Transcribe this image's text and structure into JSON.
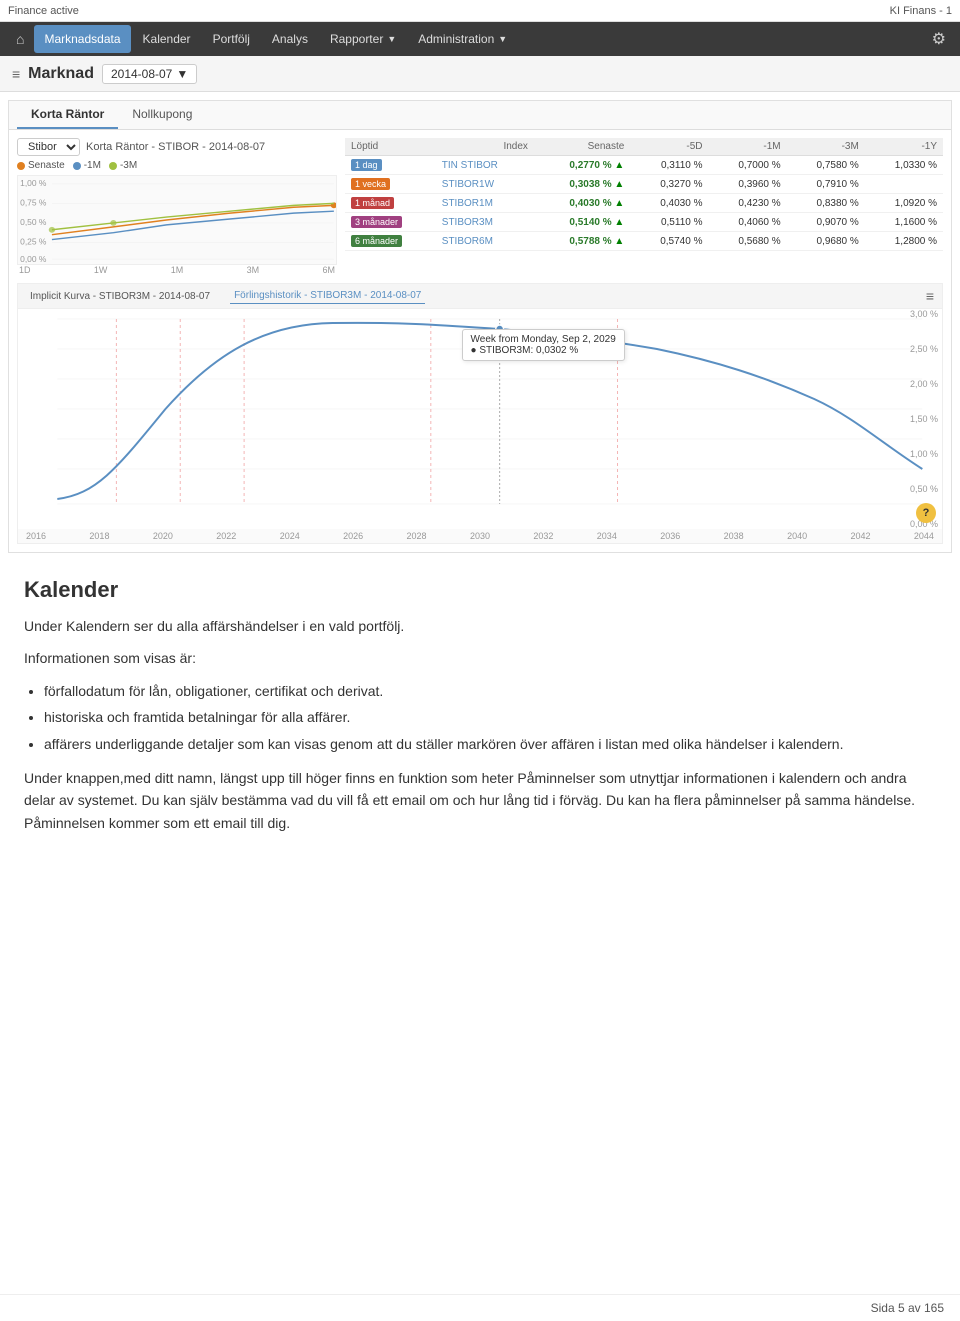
{
  "topbar": {
    "left": "Finance active",
    "right": "KI Finans - 1"
  },
  "navbar": {
    "home_icon": "⌂",
    "items": [
      {
        "label": "Marknadsdata",
        "active": true,
        "has_dropdown": false
      },
      {
        "label": "Kalender",
        "active": false,
        "has_dropdown": false
      },
      {
        "label": "Portfölj",
        "active": false,
        "has_dropdown": false
      },
      {
        "label": "Analys",
        "active": false,
        "has_dropdown": false
      },
      {
        "label": "Rapporter",
        "active": false,
        "has_dropdown": true
      },
      {
        "label": "Administration",
        "active": false,
        "has_dropdown": true
      }
    ],
    "right_icon": "⚙"
  },
  "subheader": {
    "icon": "≡",
    "title": "Marknad",
    "date": "2014-08-07",
    "date_icon": "▼"
  },
  "tabs": {
    "items": [
      {
        "label": "Korta Räntor",
        "active": true
      },
      {
        "label": "Nollkupong",
        "active": false
      }
    ]
  },
  "chart_header": {
    "title": "Korta Räntor - STIBOR - 2014-08-07",
    "stibor_label": "Stibor",
    "stibor_dropdown": "▼"
  },
  "chart_legend": [
    {
      "label": "Senaste",
      "color": "#e08020"
    },
    {
      "label": "-1M",
      "color": "#5a8fc2"
    },
    {
      "label": "-3M",
      "color": "#a0c040"
    }
  ],
  "x_axis_labels": [
    "1D",
    "1W",
    "1M",
    "3M",
    "6M"
  ],
  "data_table": {
    "headers": [
      "Löptid",
      "Index",
      "Senaste",
      "-5D",
      "-1M",
      "-3M",
      "-1Y"
    ],
    "rows": [
      {
        "period": "1 dag",
        "color_class": "1",
        "index": "TIN STIBOR",
        "senaste": "0,2770 %",
        "senaste_dir": "up",
        "d5": "0,3110 %",
        "m1": "0,7000 %",
        "m3": "0,7580 %",
        "y1": "1,0330 %"
      },
      {
        "period": "1 vecka",
        "color_class": "2",
        "index": "STIBOR1W",
        "senaste": "0,3038 %",
        "senaste_dir": "up",
        "d5": "0,3270 %",
        "m1": "0,3960 %",
        "m3": "0,7910 %",
        "y1": ""
      },
      {
        "period": "1 månad",
        "color_class": "3",
        "index": "STIBOR1M",
        "senaste": "0,4030 %",
        "senaste_dir": "up",
        "d5": "0,4030 %",
        "m1": "0,4230 %",
        "m3": "0,8380 %",
        "y1": "1,0920 %"
      },
      {
        "period": "3 månader",
        "color_class": "4",
        "index": "STIBOR3M",
        "senaste": "0,5140 %",
        "senaste_dir": "up",
        "d5": "0,5110 %",
        "m1": "0,4060 %",
        "m3": "0,9070 %",
        "y1": "1,1600 %"
      },
      {
        "period": "6 månader",
        "color_class": "5",
        "index": "STIBOR6M",
        "senaste": "0,5788 %",
        "senaste_dir": "up",
        "d5": "0,5740 %",
        "m1": "0,5680 %",
        "m3": "0,9680 %",
        "y1": "1,2800 %"
      }
    ]
  },
  "implicit_chart": {
    "tabs": [
      {
        "label": "Implicit Kurva - STIBOR3M - 2014-08-07",
        "active": false
      },
      {
        "label": "Förlingshistorik - STIBOR3M - 2014-08-07",
        "active": true
      }
    ],
    "tooltip": {
      "line1": "Week from Monday, Sep 2, 2029",
      "line2": "● STIBOR3M: 0,0302 %"
    },
    "x_labels": [
      "2016",
      "2018",
      "2020",
      "2022",
      "2024",
      "2026",
      "2028",
      "2030",
      "2032",
      "2034",
      "2036",
      "2038",
      "2040",
      "2042",
      "2044"
    ],
    "y_labels": [
      "3,00 %",
      "2,50 %",
      "2,00 %",
      "1,50 %",
      "1,00 %",
      "0,50 %",
      "0,00 %"
    ],
    "help_label": "?"
  },
  "content": {
    "section_title": "Kalender",
    "intro": "Under Kalendern ser du alla affärshändelser i en vald portfölj.",
    "info_label": "Informationen som visas är:",
    "bullets": [
      "förfallodatum för lån, obligationer, certifikat och derivat.",
      "historiska och framtida betalningar för alla affärer.",
      "affärers underliggande detaljer som kan visas genom att du ställer markören över affären i listan med olika händelser i kalendern."
    ],
    "paragraph2": "Under knappen,med ditt namn, längst upp till höger finns en funktion som heter Påminnelser som utnyttjar informationen i kalendern och andra delar av systemet. Du kan själv bestämma vad du vill få ett email om och hur lång tid i förväg. Du kan ha flera påminnelser på samma händelse. Påminnelsen kommer som ett email till dig."
  },
  "footer": {
    "page_text": "Sida 5 av 165"
  }
}
